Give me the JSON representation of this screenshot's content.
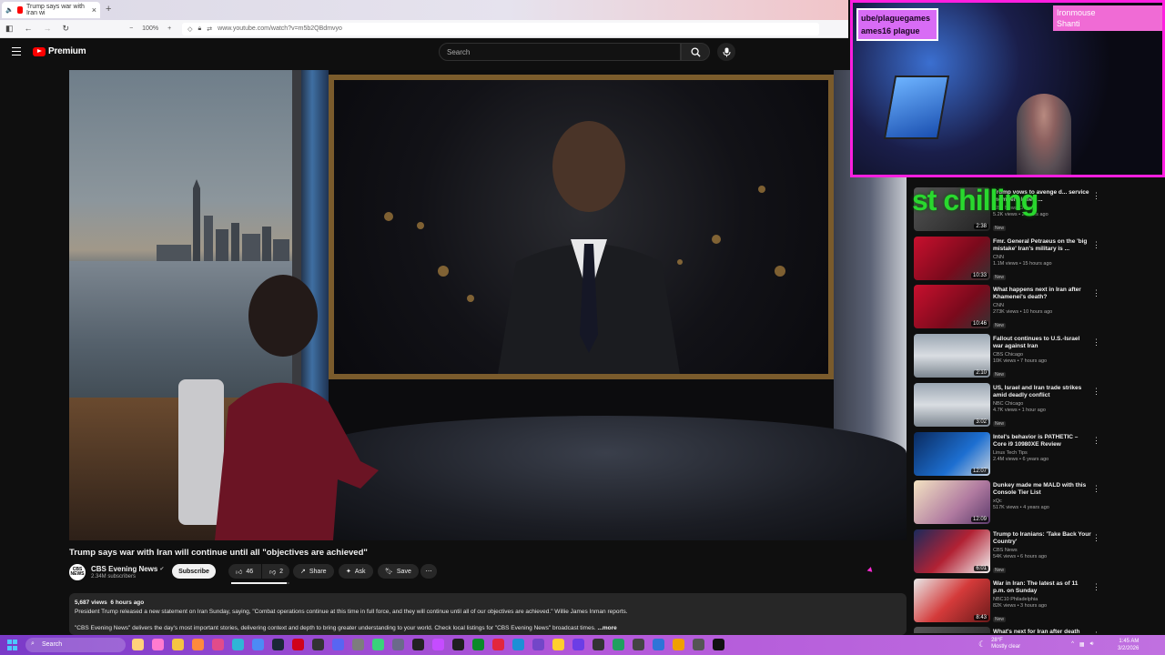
{
  "browser": {
    "tab_title": "Trump says war with Iran wi",
    "zoom": "100%",
    "url": "www.youtube.com/watch?v=m5b2QBdmvyo"
  },
  "youtube": {
    "brand": "Premium",
    "search_placeholder": "Search"
  },
  "video": {
    "title": "Trump says war with Iran will continue until all \"objectives are achieved\"",
    "channel": "CBS Evening News",
    "channel_avatar": "CBS NEWS",
    "subscribers": "2.34M subscribers",
    "subscribe_label": "Subscribe",
    "likes": "46",
    "dislikes": "2",
    "share_label": "Share",
    "ask_label": "Ask",
    "save_label": "Save",
    "views": "5,687 views",
    "age": "6 hours ago",
    "description_line1": "President Trump released a new statement on Iran Sunday, saying, \"Combat operations continue at this time in full force, and they will continue until all of our objectives are achieved.\" Willie James Inman reports.",
    "description_line2": "\"CBS Evening News\" delivers the day's most important stories, delivering context and depth to bring greater understanding to your world. Check local listings for \"CBS Evening News\" broadcast times.",
    "more_label": "...more",
    "like_ratio": 0.96
  },
  "stream_overlay": {
    "left_tag_line1": "ube/plaguegames",
    "left_tag_line2": "ames16 plague",
    "right_tag_line1": "Ironmouse",
    "right_tag_line2": "Shanti",
    "chat_text": "st chilling"
  },
  "recommendations": [
    {
      "title": "Trump vows to avenge d... service members killed ...",
      "channel": "CBS News Chicago",
      "stats": "5.2K views • 2 hours ago",
      "badge": "New",
      "duration": "2:38",
      "thumb": "cbs"
    },
    {
      "title": "Fmr. General Petraeus on the 'big mistake' Iran's military is ...",
      "channel": "CNN",
      "stats": "1.1M views • 15 hours ago",
      "badge": "New",
      "duration": "10:33",
      "thumb": "cnn"
    },
    {
      "title": "What happens next in Iran after Khamenei's death?",
      "channel": "CNN",
      "stats": "273K views • 10 hours ago",
      "badge": "New",
      "duration": "10:46",
      "thumb": "cnn"
    },
    {
      "title": "Fallout continues to U.S.-Israel war against Iran",
      "channel": "CBS Chicago",
      "stats": "10K views • 7 hours ago",
      "badge": "New",
      "duration": "2:10",
      "thumb": "missile"
    },
    {
      "title": "US, Israel and Iran trade strikes amid deadly conflict",
      "channel": "NBC Chicago",
      "stats": "4.7K views • 1 hour ago",
      "badge": "New",
      "duration": "3:02",
      "thumb": "missile"
    },
    {
      "title": "Intel's behavior is PATHETIC – Core i9 10980XE Review",
      "channel": "Linus Tech Tips",
      "stats": "2.4M views • 6 years ago",
      "badge": "",
      "duration": "12:07",
      "thumb": "intel"
    },
    {
      "title": "Dunkey made me MALD with this Console Tier List",
      "channel": "xQc",
      "stats": "517K views • 4 years ago",
      "badge": "",
      "duration": "12:09",
      "thumb": "tier"
    },
    {
      "title": "Trump to Iranians: 'Take Back Your Country'",
      "channel": "CBS News",
      "stats": "54K views • 6 hours ago",
      "badge": "New",
      "duration": "6:01",
      "thumb": "trump"
    },
    {
      "title": "War in Iran: The latest as of 11 p.m. on Sunday",
      "channel": "NBC10 Philadelphia",
      "stats": "82K views • 3 hours ago",
      "badge": "New",
      "duration": "8:43",
      "thumb": "map"
    },
    {
      "title": "What's next for Iran after death",
      "channel": "",
      "stats": "",
      "badge": "",
      "duration": "",
      "thumb": "cbs"
    }
  ],
  "taskbar": {
    "search_label": "Search",
    "weather_temp": "28°F",
    "weather_desc": "Mostly clear",
    "time": "1:45 AM",
    "date": "3/2/2026"
  },
  "colors": {
    "youtube_red": "#ff0000",
    "overlay_pink": "#ff1fe0",
    "chat_green": "#29d82e",
    "taskbar_purple": "#b257d9"
  }
}
